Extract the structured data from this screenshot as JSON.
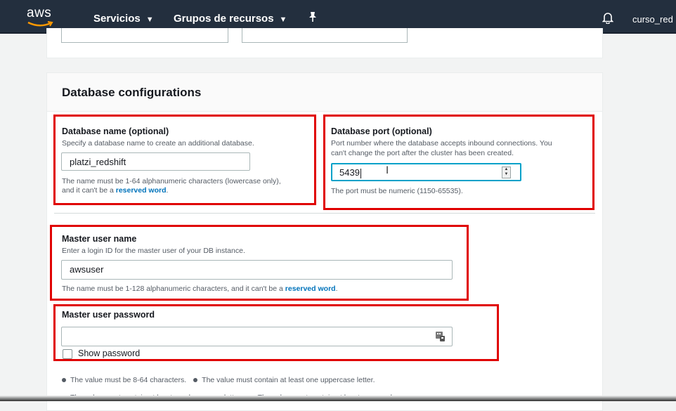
{
  "topbar": {
    "logo": "aws",
    "services": "Servicios",
    "resource_groups": "Grupos de recursos",
    "username": "curso_red",
    "icons": {
      "pin": "pin-icon",
      "bell": "bell-icon"
    }
  },
  "section": {
    "title": "Database configurations"
  },
  "db_name": {
    "label": "Database name (optional)",
    "description": "Specify a database name to create an additional database.",
    "value": "platzi_redshift",
    "hint_line1": "The name must be 1-64 alphanumeric characters (lowercase only),",
    "hint_line2": "and it can't be a",
    "hint_link": "reserved word",
    "hint_end": "."
  },
  "db_port": {
    "label": "Database port (optional)",
    "description_line1": "Port number where the database accepts inbound connections. You",
    "description_line2": "can't change the port after the cluster has been created.",
    "value": "5439",
    "hint": "The port must be numeric (1150-65535)."
  },
  "master_user": {
    "label": "Master user name",
    "description": "Enter a login ID for the master user of your DB instance.",
    "value": "awsuser",
    "hint": "The name must be 1-128 alphanumeric characters, and it can't be a",
    "hint_link": "reserved word",
    "hint_end": "."
  },
  "master_password": {
    "label": "Master user password",
    "value": "",
    "show_password_label": "Show password",
    "show_password_checked": false
  },
  "password_rules": [
    "The value must be 8-64 characters.",
    "The value must contain at least one uppercase letter.",
    "The value must contain at least one lowercase letter.",
    "The value must contain at least one number."
  ],
  "colors": {
    "topbar": "#232f3e",
    "highlight": "#e00000",
    "link": "#0073bb",
    "focus": "#00a1c9"
  }
}
